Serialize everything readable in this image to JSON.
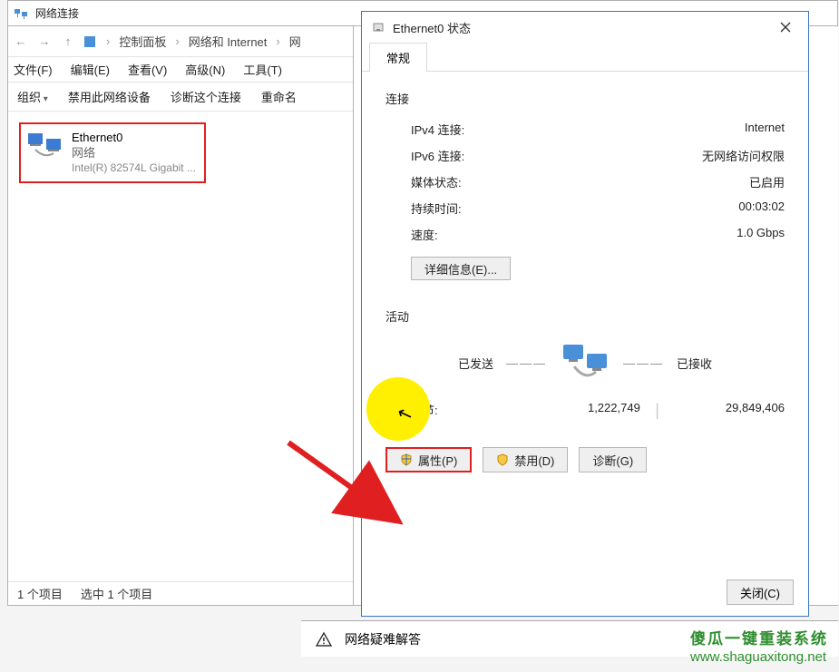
{
  "window": {
    "title": "网络连接",
    "breadcrumbs": [
      "控制面板",
      "网络和 Internet",
      "网"
    ],
    "menus": {
      "file": "文件(F)",
      "edit": "编辑(E)",
      "view": "查看(V)",
      "advanced": "高级(N)",
      "tools": "工具(T)"
    },
    "toolbar": {
      "organize": "组织",
      "disable": "禁用此网络设备",
      "diagnose": "诊断这个连接",
      "rename": "重命名"
    },
    "adapter": {
      "name": "Ethernet0",
      "status": "网络",
      "device": "Intel(R) 82574L Gigabit ..."
    },
    "statusbar": {
      "count": "1 个项目",
      "selected": "选中 1 个项目"
    }
  },
  "dialog": {
    "title": "Ethernet0 状态",
    "tab": "常规",
    "connection": {
      "heading": "连接",
      "ipv4_label": "IPv4 连接:",
      "ipv4_value": "Internet",
      "ipv6_label": "IPv6 连接:",
      "ipv6_value": "无网络访问权限",
      "media_label": "媒体状态:",
      "media_value": "已启用",
      "duration_label": "持续时间:",
      "duration_value": "00:03:02",
      "speed_label": "速度:",
      "speed_value": "1.0 Gbps",
      "details_btn": "详细信息(E)..."
    },
    "activity": {
      "heading": "活动",
      "sent_label": "已发送",
      "recv_label": "已接收",
      "bytes_label": "字节:",
      "sent_bytes": "1,222,749",
      "recv_bytes": "29,849,406"
    },
    "buttons": {
      "properties": "属性(P)",
      "disable": "禁用(D)",
      "diagnose": "诊断(G)",
      "close": "关闭(C)"
    }
  },
  "troubleshoot": {
    "label": "网络疑难解答"
  },
  "watermark": {
    "line1": "傻瓜一键重装系统",
    "line2": "www.shaguaxitong.net"
  }
}
